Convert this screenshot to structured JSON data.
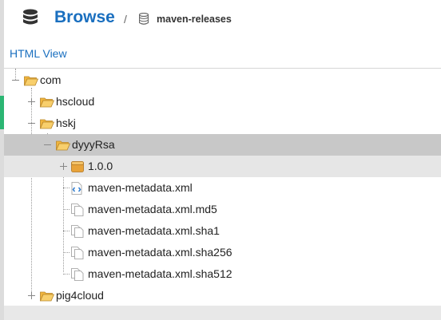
{
  "header": {
    "title": "Browse",
    "separator": "/",
    "repository": "maven-releases"
  },
  "view_link": "HTML View",
  "tree": {
    "com": "com",
    "hscloud": "hscloud",
    "hskj": "hskj",
    "dyyyRsa": "dyyyRsa",
    "version": "1.0.0",
    "files": [
      "maven-metadata.xml",
      "maven-metadata.xml.md5",
      "maven-metadata.xml.sha1",
      "maven-metadata.xml.sha256",
      "maven-metadata.xml.sha512"
    ],
    "pig4cloud": "pig4cloud"
  },
  "icons": {
    "database": "database-icon",
    "repository": "repository-icon",
    "folder": "folder-icon",
    "component": "component-icon",
    "xml_file": "xml-file-icon",
    "file": "file-icon"
  },
  "colors": {
    "accent": "#1a6fbf",
    "active_indicator": "#2bb673",
    "selected_row": "#c8c8c8",
    "folder": "#f1b53d"
  }
}
